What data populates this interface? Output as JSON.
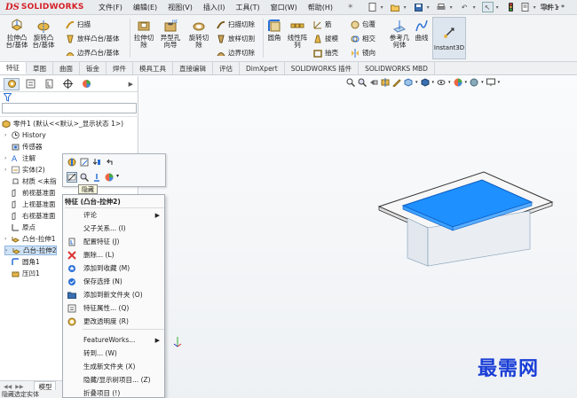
{
  "app": {
    "brand_mark": "DS",
    "brand_name": "SOLIDWORKS",
    "menus": [
      "文件(F)",
      "编辑(E)",
      "视图(V)",
      "插入(I)",
      "工具(T)",
      "窗口(W)",
      "帮助(H)"
    ],
    "document_title": "零件1 *"
  },
  "ribbon": {
    "boss_extrude": "拉伸凸\n台/基体",
    "boss_revolve": "旋转凸\n台/基体",
    "sweep": "扫描",
    "loft": "放样凸台/基体",
    "boundary": "边界凸台/基体",
    "cut_extrude": "拉伸切\n除",
    "hole_wizard": "异型孔\n向导",
    "cut_revolve": "旋转切\n除",
    "swept_cut": "扫描切除",
    "lofted_cut": "放样切割",
    "boundary_cut": "边界切除",
    "fillet": "圆角",
    "linear_pattern": "线性阵\n列",
    "rib": "筋",
    "draft": "拔模",
    "shell": "抽壳",
    "wrap": "包覆",
    "intersect": "相交",
    "mirror": "镜向",
    "ref_geometry": "参考几\n何体",
    "curves": "曲线",
    "instant3d": "Instant3D"
  },
  "tabs": [
    "特征",
    "草图",
    "曲面",
    "钣金",
    "焊件",
    "模具工具",
    "直接编辑",
    "评估",
    "DimXpert",
    "SOLIDWORKS 插件",
    "SOLIDWORKS MBD"
  ],
  "active_tab": "特征",
  "tree": {
    "root": "零件1 (默认<<默认>_显示状态 1>)",
    "items": [
      "History",
      "传感器",
      "注解",
      "实体(2)",
      "材质 <未指",
      "前视基准面",
      "上视基准面",
      "右视基准面",
      "原点",
      "凸台-拉伸1",
      "凸台-拉伸2",
      "圆角1",
      "压凹1"
    ],
    "selected": "凸台-拉伸2"
  },
  "bottom_tab": "模型",
  "status_text": "隐藏选定实体",
  "tooltip": "隐藏",
  "context_menu": {
    "header": "特征 (凸台-拉伸2)",
    "items": [
      {
        "label": "评论",
        "submenu": true
      },
      {
        "label": "父子关系... (I)"
      },
      {
        "label": "配置特征 (J)"
      },
      {
        "label": "删除... (L)"
      },
      {
        "label": "添加到收藏 (M)"
      },
      {
        "label": "保存选择 (N)"
      },
      {
        "label": "添加到新文件夹 (O)"
      },
      {
        "label": "特征属性... (Q)"
      },
      {
        "label": "更改透明度 (R)"
      },
      {
        "label": "FeatureWorks...",
        "submenu": true
      },
      {
        "label": "转到... (W)"
      },
      {
        "label": "生成新文件夹 (X)"
      },
      {
        "label": "隐藏/显示树项目... (Z)"
      },
      {
        "label": "折叠项目 (!)"
      }
    ]
  },
  "watermark": "最需网",
  "colors": {
    "brand_red": "#d42027",
    "selection_blue": "#1e90ff",
    "watermark_blue": "#1a3ed6"
  }
}
